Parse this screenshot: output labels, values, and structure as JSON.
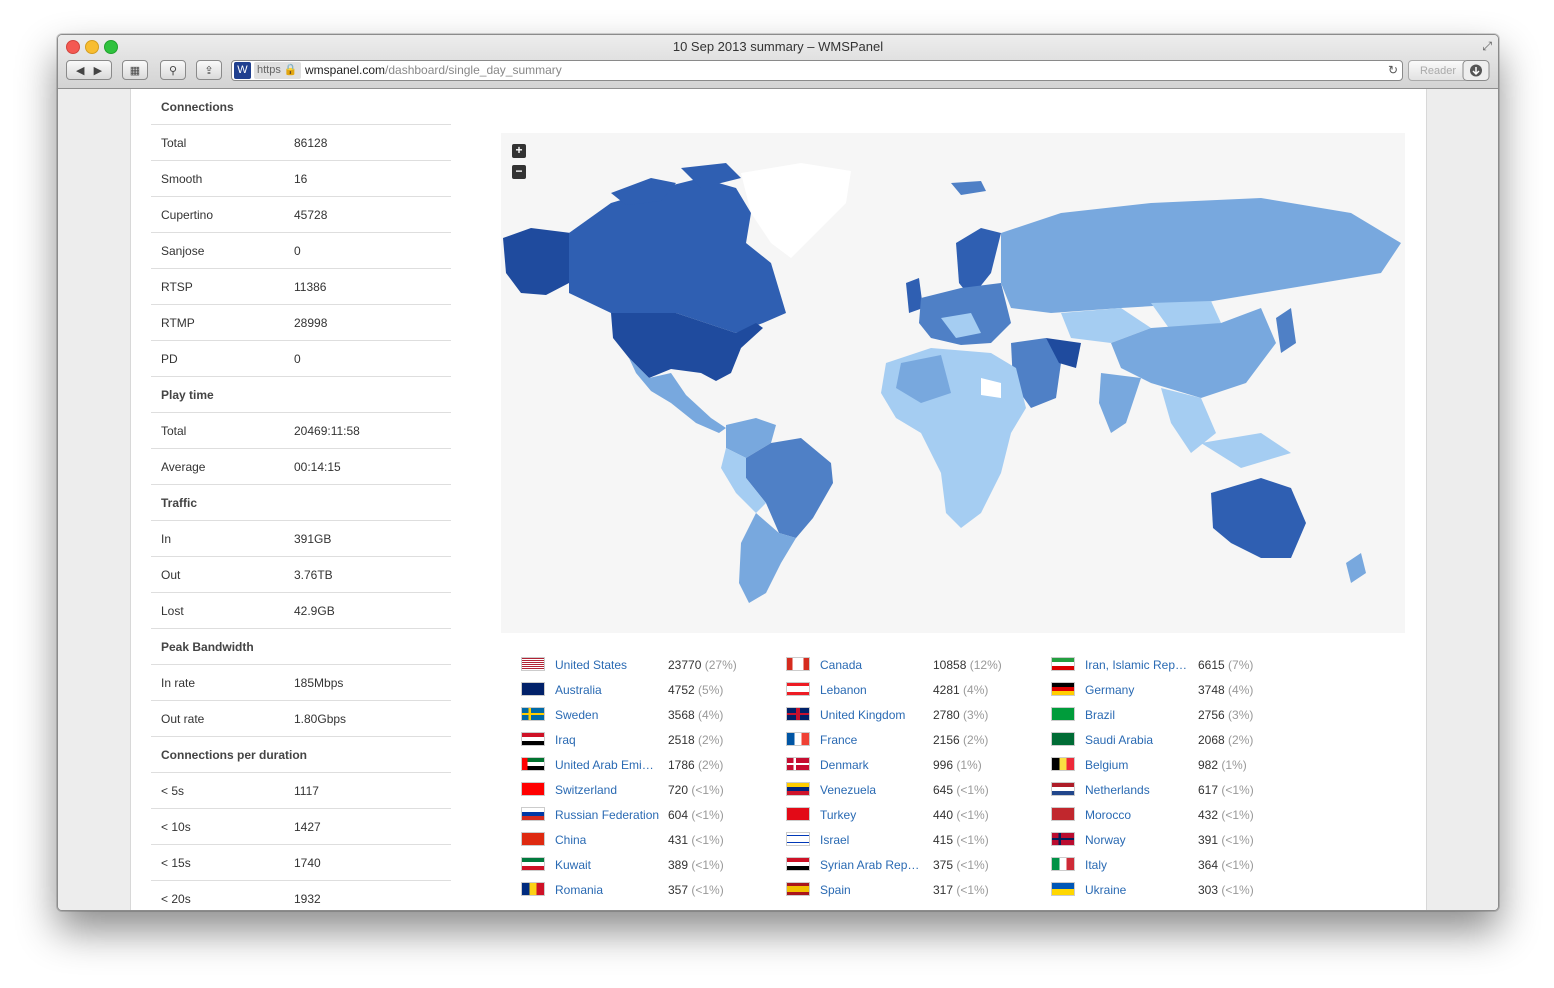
{
  "window": {
    "title": "10 Sep 2013 summary – WMSPanel"
  },
  "toolbar": {
    "back": "◀",
    "forward": "▶",
    "url_scheme": "https",
    "url_host": "wmspanel.com",
    "url_path": "/dashboard/single_day_summary",
    "reader_label": "Reader",
    "favicon_letter": "W"
  },
  "stats": [
    {
      "label": "Connections",
      "value": "",
      "head": true
    },
    {
      "label": "Total",
      "value": "86128"
    },
    {
      "label": "Smooth",
      "value": "16"
    },
    {
      "label": "Cupertino",
      "value": "45728"
    },
    {
      "label": "Sanjose",
      "value": "0"
    },
    {
      "label": "RTSP",
      "value": "11386"
    },
    {
      "label": "RTMP",
      "value": "28998"
    },
    {
      "label": "PD",
      "value": "0"
    },
    {
      "label": "Play time",
      "value": "",
      "head": true
    },
    {
      "label": "Total",
      "value": "20469:11:58"
    },
    {
      "label": "Average",
      "value": "00:14:15"
    },
    {
      "label": "Traffic",
      "value": "",
      "head": true
    },
    {
      "label": "In",
      "value": "391GB"
    },
    {
      "label": "Out",
      "value": "3.76TB"
    },
    {
      "label": "Lost",
      "value": "42.9GB"
    },
    {
      "label": "Peak Bandwidth",
      "value": "",
      "head": true
    },
    {
      "label": "In rate",
      "value": "185Mbps"
    },
    {
      "label": "Out rate",
      "value": "1.80Gbps"
    },
    {
      "label": "Connections per duration",
      "value": "",
      "head": true
    },
    {
      "label": "< 5s",
      "value": "1117"
    },
    {
      "label": "< 10s",
      "value": "1427"
    },
    {
      "label": "< 15s",
      "value": "1740"
    },
    {
      "label": "< 20s",
      "value": "1932"
    }
  ],
  "map": {
    "zoom_in": "+",
    "zoom_out": "−"
  },
  "countries": [
    {
      "name": "United States",
      "count": "23770",
      "pct": "(27%)",
      "flag": "us"
    },
    {
      "name": "Canada",
      "count": "10858",
      "pct": "(12%)",
      "flag": "ca"
    },
    {
      "name": "Iran, Islamic Rep…",
      "count": "6615",
      "pct": "(7%)",
      "flag": "ir"
    },
    {
      "name": "Australia",
      "count": "4752",
      "pct": "(5%)",
      "flag": "au"
    },
    {
      "name": "Lebanon",
      "count": "4281",
      "pct": "(4%)",
      "flag": "lb"
    },
    {
      "name": "Germany",
      "count": "3748",
      "pct": "(4%)",
      "flag": "de"
    },
    {
      "name": "Sweden",
      "count": "3568",
      "pct": "(4%)",
      "flag": "se"
    },
    {
      "name": "United Kingdom",
      "count": "2780",
      "pct": "(3%)",
      "flag": "gb"
    },
    {
      "name": "Brazil",
      "count": "2756",
      "pct": "(3%)",
      "flag": "br"
    },
    {
      "name": "Iraq",
      "count": "2518",
      "pct": "(2%)",
      "flag": "iq"
    },
    {
      "name": "France",
      "count": "2156",
      "pct": "(2%)",
      "flag": "fr"
    },
    {
      "name": "Saudi Arabia",
      "count": "2068",
      "pct": "(2%)",
      "flag": "sa"
    },
    {
      "name": "United Arab Emi…",
      "count": "1786",
      "pct": "(2%)",
      "flag": "ae"
    },
    {
      "name": "Denmark",
      "count": "996",
      "pct": "(1%)",
      "flag": "dk"
    },
    {
      "name": "Belgium",
      "count": "982",
      "pct": "(1%)",
      "flag": "be"
    },
    {
      "name": "Switzerland",
      "count": "720",
      "pct": "(<1%)",
      "flag": "ch"
    },
    {
      "name": "Venezuela",
      "count": "645",
      "pct": "(<1%)",
      "flag": "ve"
    },
    {
      "name": "Netherlands",
      "count": "617",
      "pct": "(<1%)",
      "flag": "nl"
    },
    {
      "name": "Russian Federation",
      "count": "604",
      "pct": "(<1%)",
      "flag": "ru"
    },
    {
      "name": "Turkey",
      "count": "440",
      "pct": "(<1%)",
      "flag": "tr"
    },
    {
      "name": "Morocco",
      "count": "432",
      "pct": "(<1%)",
      "flag": "ma"
    },
    {
      "name": "China",
      "count": "431",
      "pct": "(<1%)",
      "flag": "cn"
    },
    {
      "name": "Israel",
      "count": "415",
      "pct": "(<1%)",
      "flag": "il"
    },
    {
      "name": "Norway",
      "count": "391",
      "pct": "(<1%)",
      "flag": "no"
    },
    {
      "name": "Kuwait",
      "count": "389",
      "pct": "(<1%)",
      "flag": "kw"
    },
    {
      "name": "Syrian Arab Rep…",
      "count": "375",
      "pct": "(<1%)",
      "flag": "sy"
    },
    {
      "name": "Italy",
      "count": "364",
      "pct": "(<1%)",
      "flag": "it"
    },
    {
      "name": "Romania",
      "count": "357",
      "pct": "(<1%)",
      "flag": "ro"
    },
    {
      "name": "Spain",
      "count": "317",
      "pct": "(<1%)",
      "flag": "es"
    },
    {
      "name": "Ukraine",
      "count": "303",
      "pct": "(<1%)",
      "flag": "ua"
    }
  ],
  "colors": {
    "map_darkest": "#1f4b9e",
    "map_dark": "#2f5fb2",
    "map_mid": "#4f80c6",
    "map_light": "#78a8de",
    "map_lighter": "#a5cdf2",
    "map_none": "#ffffff",
    "link": "#2a6ab3"
  }
}
